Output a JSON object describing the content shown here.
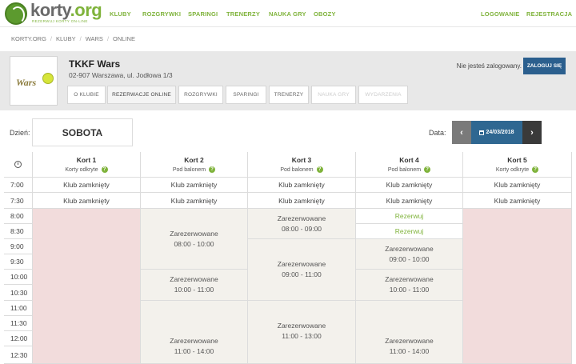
{
  "brand": {
    "name": "korty",
    "tld": ".org",
    "tagline": "REZERWUJ KORTY ON-LINE"
  },
  "topnav": {
    "items": [
      "KLUBY",
      "ROZGRYWKI",
      "SPARINGI",
      "TRENERZY",
      "NAUKA GRY",
      "OBOZY"
    ],
    "login": "LOGOWANIE",
    "register": "REJESTRACJA"
  },
  "breadcrumb": [
    "KORTY.ORG",
    "KLUBY",
    "WARS",
    "ONLINE"
  ],
  "club": {
    "logo_text": "Wars",
    "name": "TKKF Wars",
    "address": "02-907 Warszawa, ul. Jodłowa 1/3",
    "tabs": [
      "O KLUBIE",
      "REZERWACJE ONLINE",
      "ROZGRYWKI",
      "SPARINGI",
      "TRENERZY",
      "NAUKA GRY",
      "WYDARZENIA"
    ],
    "not_logged": "Nie jesteś zalogowany.",
    "login_button": "ZALOGUJ SIĘ"
  },
  "day": {
    "label": "Dzień:",
    "value": "SOBOTA"
  },
  "date": {
    "label": "Data:",
    "value": "24/03/2018",
    "prev": "‹",
    "next": "›"
  },
  "courts": [
    {
      "name": "Kort 1",
      "type": "Korty odkryte",
      "help": "?"
    },
    {
      "name": "Kort 2",
      "type": "Pod balonem",
      "help": "?"
    },
    {
      "name": "Kort 3",
      "type": "Pod balonem",
      "help": "?"
    },
    {
      "name": "Kort 4",
      "type": "Pod balonem",
      "help": "?"
    },
    {
      "name": "Kort 5",
      "type": "Korty odkryte",
      "help": "?"
    }
  ],
  "times": [
    "7:00",
    "7:30",
    "8:00",
    "8:30",
    "9:00",
    "9:30",
    "10:00",
    "10:30",
    "11:00",
    "11:30",
    "12:00",
    "12:30"
  ],
  "closed_label": "Klub zamknięty",
  "free_label": "Rezerwuj",
  "reserved_label": "Zarezerwowane",
  "reservations": [
    {
      "range": "08:00 - 10:00"
    },
    {
      "range": "10:00 - 11:00"
    },
    {
      "range": "11:00 - 14:00"
    },
    {
      "range": "08:00 - 09:00"
    },
    {
      "range": "09:00 - 11:00"
    },
    {
      "range": "11:00 - 13:00"
    },
    {
      "range": "09:00 - 10:00"
    },
    {
      "range": "10:00 - 11:00"
    },
    {
      "range": "11:00 - 14:00"
    }
  ]
}
